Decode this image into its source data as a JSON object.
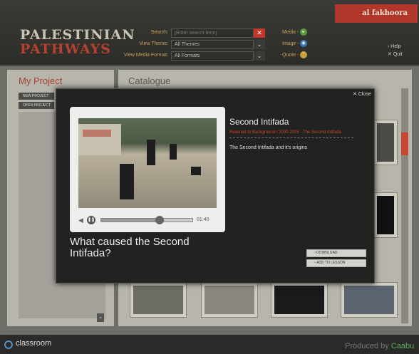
{
  "header": {
    "logo_line1": "PALESTINIAN",
    "logo_line2": "PATHWAYS",
    "brand": "al fakhoora",
    "search_label": "Search:",
    "search_placeholder": "[Enter search term]",
    "view_theme_label": "View Theme:",
    "view_theme_value": "All Themes",
    "view_format_label": "View Media Format:",
    "view_format_value": "All Formats",
    "media_labels": [
      "Media -",
      "Image -",
      "Quote -"
    ],
    "help": "Help",
    "quit": "Quit"
  },
  "left_panel": {
    "title": "My Project",
    "buttons": [
      "NEW PROJECT",
      "OPEN PROJECT"
    ]
  },
  "catalogue": {
    "title": "Catalogue"
  },
  "modal": {
    "close": "Close",
    "title": "Second Intifada",
    "subtitle": "Relevant to Background / 2000-2005 - The Second Intifada",
    "description": "The Second Intifada and it's origins",
    "question": "What caused the Second Intifada?",
    "timecode": "01:40",
    "progress_fraction": 0.62,
    "buttons": [
      "DOWNLOAD",
      "ADD TO LESSON"
    ]
  },
  "footer": {
    "classroom": "classroom",
    "produced_by": "Produced by",
    "producer": "Caabu"
  },
  "colors": {
    "accent_red": "#b6412e",
    "scroll_accent": "#c9452f",
    "producer_green": "#5dae5d"
  }
}
